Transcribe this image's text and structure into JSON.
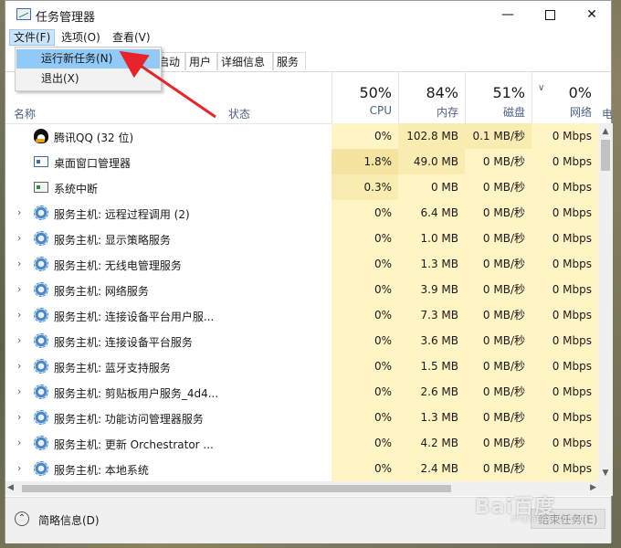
{
  "window": {
    "title": "任务管理器"
  },
  "titlebar": {
    "min_glyph": "—",
    "close_glyph": "✕"
  },
  "menubar": {
    "file": "文件(F)",
    "options": "选项(O)",
    "view": "查看(V)"
  },
  "file_menu": {
    "items": [
      {
        "label": "运行新任务(N)"
      },
      {
        "label": "退出(X)"
      }
    ]
  },
  "tabs": {
    "startup": "启动",
    "users": "用户",
    "details": "详细信息",
    "services": "服务"
  },
  "header": {
    "name": "名称",
    "status": "状态",
    "cpu": {
      "pct": "50%",
      "label": "CPU"
    },
    "memory": {
      "pct": "84%",
      "label": "内存"
    },
    "disk": {
      "pct": "51%",
      "label": "磁盘"
    },
    "network": {
      "pct": "0%",
      "label": "网络"
    },
    "power": "电",
    "sort_indicator": "chevron-down-icon"
  },
  "rows": [
    {
      "name": "腾讯QQ (32 位)",
      "icon": "qq-penguin-icon",
      "expandable": false,
      "cpu": "0%",
      "memory": "102.8 MB",
      "disk": "0.1 MB/秒",
      "network": "0 Mbps"
    },
    {
      "name": "桌面窗口管理器",
      "icon": "window-icon",
      "expandable": false,
      "cpu": "1.8%",
      "memory": "49.0 MB",
      "disk": "0 MB/秒",
      "network": "0 Mbps"
    },
    {
      "name": "系统中断",
      "icon": "chip-icon",
      "expandable": false,
      "cpu": "0.3%",
      "memory": "0 MB",
      "disk": "0 MB/秒",
      "network": "0 Mbps"
    },
    {
      "name": "服务主机: 远程过程调用 (2)",
      "icon": "gear-icon",
      "expandable": true,
      "cpu": "0%",
      "memory": "6.4 MB",
      "disk": "0 MB/秒",
      "network": "0 Mbps"
    },
    {
      "name": "服务主机: 显示策略服务",
      "icon": "gear-icon",
      "expandable": true,
      "cpu": "0%",
      "memory": "1.0 MB",
      "disk": "0 MB/秒",
      "network": "0 Mbps"
    },
    {
      "name": "服务主机: 无线电管理服务",
      "icon": "gear-icon",
      "expandable": true,
      "cpu": "0%",
      "memory": "1.3 MB",
      "disk": "0 MB/秒",
      "network": "0 Mbps"
    },
    {
      "name": "服务主机: 网络服务",
      "icon": "gear-icon",
      "expandable": true,
      "cpu": "0%",
      "memory": "3.9 MB",
      "disk": "0 MB/秒",
      "network": "0 Mbps"
    },
    {
      "name": "服务主机: 连接设备平台用户服...",
      "icon": "gear-icon",
      "expandable": true,
      "cpu": "0%",
      "memory": "7.3 MB",
      "disk": "0 MB/秒",
      "network": "0 Mbps"
    },
    {
      "name": "服务主机: 连接设备平台服务",
      "icon": "gear-icon",
      "expandable": true,
      "cpu": "0%",
      "memory": "3.6 MB",
      "disk": "0 MB/秒",
      "network": "0 Mbps"
    },
    {
      "name": "服务主机: 蓝牙支持服务",
      "icon": "gear-icon",
      "expandable": true,
      "cpu": "0%",
      "memory": "1.5 MB",
      "disk": "0 MB/秒",
      "network": "0 Mbps"
    },
    {
      "name": "服务主机: 剪贴板用户服务_4d4...",
      "icon": "gear-icon",
      "expandable": true,
      "cpu": "0%",
      "memory": "2.6 MB",
      "disk": "0 MB/秒",
      "network": "0 Mbps"
    },
    {
      "name": "服务主机: 功能访问管理器服务",
      "icon": "gear-icon",
      "expandable": true,
      "cpu": "0%",
      "memory": "1.3 MB",
      "disk": "0 MB/秒",
      "network": "0 Mbps"
    },
    {
      "name": "服务主机: 更新 Orchestrator ...",
      "icon": "gear-icon",
      "expandable": true,
      "cpu": "0%",
      "memory": "4.2 MB",
      "disk": "0 MB/秒",
      "network": "0 Mbps"
    },
    {
      "name": "服务主机: 本地系统",
      "icon": "gear-icon",
      "expandable": true,
      "cpu": "0%",
      "memory": "2.4 MB",
      "disk": "0 MB/秒",
      "network": "0 Mbps"
    }
  ],
  "footer": {
    "fewer_details": "简略信息(D)",
    "end_task": "结束任务(E)"
  },
  "watermark": {
    "text": "Bai百度",
    "sub": "jingyan.baidu.com"
  },
  "colors": {
    "cpu_low": "#fff4c4",
    "cpu_mid": "#f9ecb0",
    "cpu_high": "#f5e4a0",
    "menu_highlight": "#91c9f7",
    "annotation_arrow": "#e8232a"
  }
}
